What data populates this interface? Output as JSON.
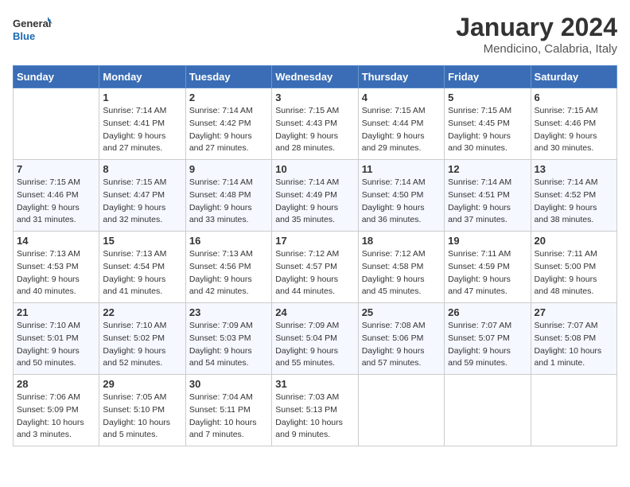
{
  "header": {
    "logo_line1": "General",
    "logo_line2": "Blue",
    "month": "January 2024",
    "location": "Mendicino, Calabria, Italy"
  },
  "weekdays": [
    "Sunday",
    "Monday",
    "Tuesday",
    "Wednesday",
    "Thursday",
    "Friday",
    "Saturday"
  ],
  "weeks": [
    [
      {
        "day": "",
        "info": ""
      },
      {
        "day": "1",
        "info": "Sunrise: 7:14 AM\nSunset: 4:41 PM\nDaylight: 9 hours\nand 27 minutes."
      },
      {
        "day": "2",
        "info": "Sunrise: 7:14 AM\nSunset: 4:42 PM\nDaylight: 9 hours\nand 27 minutes."
      },
      {
        "day": "3",
        "info": "Sunrise: 7:15 AM\nSunset: 4:43 PM\nDaylight: 9 hours\nand 28 minutes."
      },
      {
        "day": "4",
        "info": "Sunrise: 7:15 AM\nSunset: 4:44 PM\nDaylight: 9 hours\nand 29 minutes."
      },
      {
        "day": "5",
        "info": "Sunrise: 7:15 AM\nSunset: 4:45 PM\nDaylight: 9 hours\nand 30 minutes."
      },
      {
        "day": "6",
        "info": "Sunrise: 7:15 AM\nSunset: 4:46 PM\nDaylight: 9 hours\nand 30 minutes."
      }
    ],
    [
      {
        "day": "7",
        "info": "Sunrise: 7:15 AM\nSunset: 4:46 PM\nDaylight: 9 hours\nand 31 minutes."
      },
      {
        "day": "8",
        "info": "Sunrise: 7:15 AM\nSunset: 4:47 PM\nDaylight: 9 hours\nand 32 minutes."
      },
      {
        "day": "9",
        "info": "Sunrise: 7:14 AM\nSunset: 4:48 PM\nDaylight: 9 hours\nand 33 minutes."
      },
      {
        "day": "10",
        "info": "Sunrise: 7:14 AM\nSunset: 4:49 PM\nDaylight: 9 hours\nand 35 minutes."
      },
      {
        "day": "11",
        "info": "Sunrise: 7:14 AM\nSunset: 4:50 PM\nDaylight: 9 hours\nand 36 minutes."
      },
      {
        "day": "12",
        "info": "Sunrise: 7:14 AM\nSunset: 4:51 PM\nDaylight: 9 hours\nand 37 minutes."
      },
      {
        "day": "13",
        "info": "Sunrise: 7:14 AM\nSunset: 4:52 PM\nDaylight: 9 hours\nand 38 minutes."
      }
    ],
    [
      {
        "day": "14",
        "info": "Sunrise: 7:13 AM\nSunset: 4:53 PM\nDaylight: 9 hours\nand 40 minutes."
      },
      {
        "day": "15",
        "info": "Sunrise: 7:13 AM\nSunset: 4:54 PM\nDaylight: 9 hours\nand 41 minutes."
      },
      {
        "day": "16",
        "info": "Sunrise: 7:13 AM\nSunset: 4:56 PM\nDaylight: 9 hours\nand 42 minutes."
      },
      {
        "day": "17",
        "info": "Sunrise: 7:12 AM\nSunset: 4:57 PM\nDaylight: 9 hours\nand 44 minutes."
      },
      {
        "day": "18",
        "info": "Sunrise: 7:12 AM\nSunset: 4:58 PM\nDaylight: 9 hours\nand 45 minutes."
      },
      {
        "day": "19",
        "info": "Sunrise: 7:11 AM\nSunset: 4:59 PM\nDaylight: 9 hours\nand 47 minutes."
      },
      {
        "day": "20",
        "info": "Sunrise: 7:11 AM\nSunset: 5:00 PM\nDaylight: 9 hours\nand 48 minutes."
      }
    ],
    [
      {
        "day": "21",
        "info": "Sunrise: 7:10 AM\nSunset: 5:01 PM\nDaylight: 9 hours\nand 50 minutes."
      },
      {
        "day": "22",
        "info": "Sunrise: 7:10 AM\nSunset: 5:02 PM\nDaylight: 9 hours\nand 52 minutes."
      },
      {
        "day": "23",
        "info": "Sunrise: 7:09 AM\nSunset: 5:03 PM\nDaylight: 9 hours\nand 54 minutes."
      },
      {
        "day": "24",
        "info": "Sunrise: 7:09 AM\nSunset: 5:04 PM\nDaylight: 9 hours\nand 55 minutes."
      },
      {
        "day": "25",
        "info": "Sunrise: 7:08 AM\nSunset: 5:06 PM\nDaylight: 9 hours\nand 57 minutes."
      },
      {
        "day": "26",
        "info": "Sunrise: 7:07 AM\nSunset: 5:07 PM\nDaylight: 9 hours\nand 59 minutes."
      },
      {
        "day": "27",
        "info": "Sunrise: 7:07 AM\nSunset: 5:08 PM\nDaylight: 10 hours\nand 1 minute."
      }
    ],
    [
      {
        "day": "28",
        "info": "Sunrise: 7:06 AM\nSunset: 5:09 PM\nDaylight: 10 hours\nand 3 minutes."
      },
      {
        "day": "29",
        "info": "Sunrise: 7:05 AM\nSunset: 5:10 PM\nDaylight: 10 hours\nand 5 minutes."
      },
      {
        "day": "30",
        "info": "Sunrise: 7:04 AM\nSunset: 5:11 PM\nDaylight: 10 hours\nand 7 minutes."
      },
      {
        "day": "31",
        "info": "Sunrise: 7:03 AM\nSunset: 5:13 PM\nDaylight: 10 hours\nand 9 minutes."
      },
      {
        "day": "",
        "info": ""
      },
      {
        "day": "",
        "info": ""
      },
      {
        "day": "",
        "info": ""
      }
    ]
  ]
}
